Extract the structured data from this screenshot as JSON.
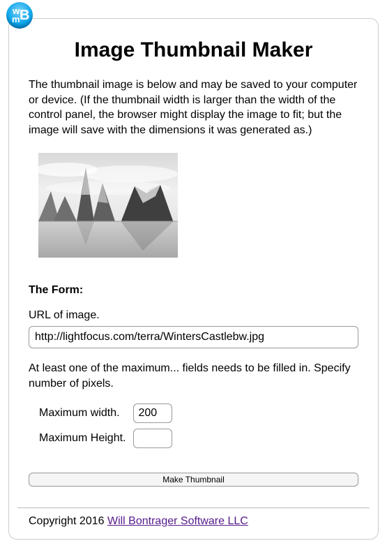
{
  "logo": {
    "name": "wmb-logo"
  },
  "title": "Image Thumbnail Maker",
  "description": "The thumbnail image is below and may be saved to your computer or device. (If the thumbnail width is larger than the width of the control panel, the browser might display the image to fit; but the image will save with the dimensions it was generated as.)",
  "form": {
    "heading": "The Form:",
    "url_label": "URL of image.",
    "url_value": "http://lightfocus.com/terra/WintersCastlebw.jpg",
    "hint": "At least one of the maximum... fields needs to be filled in. Specify number of pixels.",
    "max_width_label": "Maximum width.",
    "max_width_value": "200",
    "max_height_label": "Maximum Height.",
    "max_height_value": "",
    "submit_label": "Make Thumbnail"
  },
  "footer": {
    "copyright_prefix": "Copyright 2016 ",
    "link_text": "Will Bontrager Software LLC"
  }
}
